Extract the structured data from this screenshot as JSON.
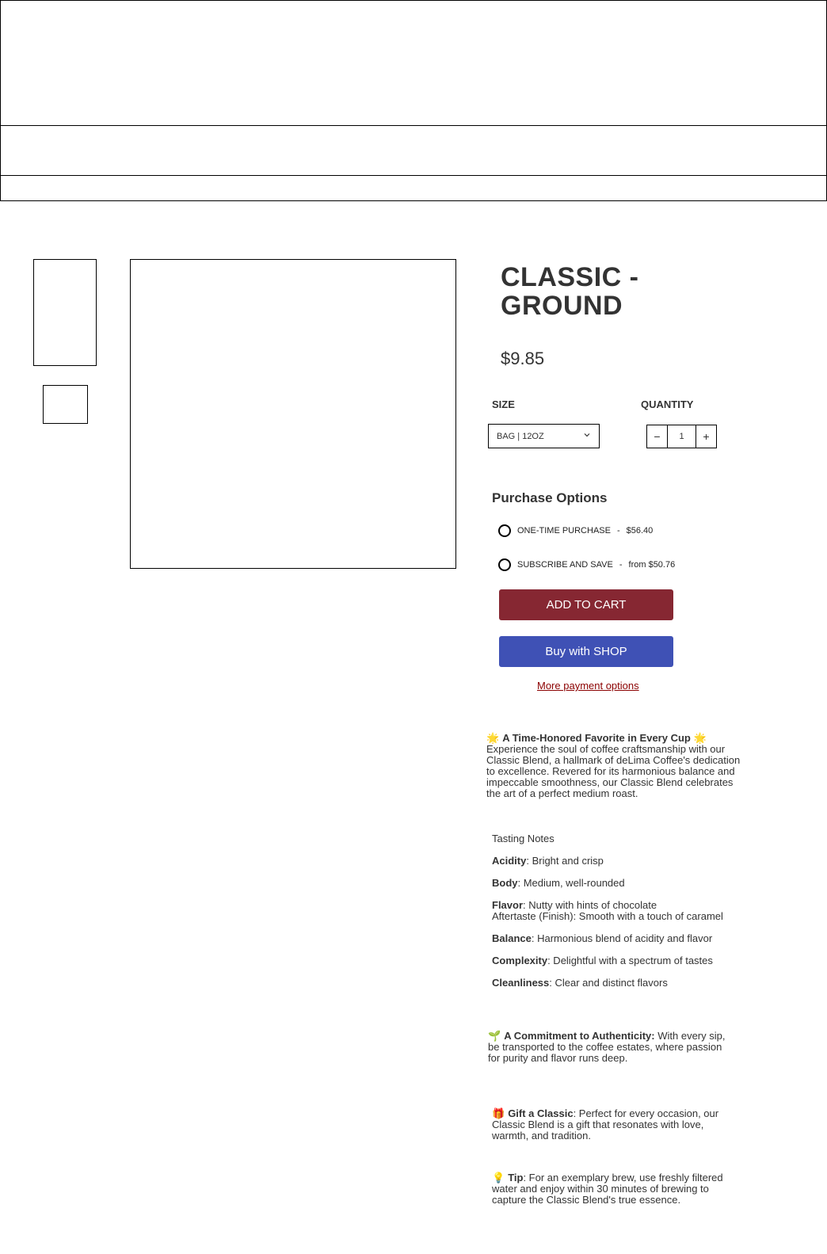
{
  "product": {
    "title": "CLASSIC - GROUND",
    "price": "$9.85",
    "size_label": "SIZE",
    "size_value": "BAG | 12OZ",
    "quantity_label": "QUANTITY",
    "quantity_value": "1",
    "minus": "−",
    "plus": "+"
  },
  "purchase": {
    "title": "Purchase Options",
    "options": [
      {
        "label": "ONE-TIME PURCHASE",
        "sep": "-",
        "price": "$56.40"
      },
      {
        "label": "SUBSCRIBE AND SAVE",
        "sep": "-",
        "price": "from $50.76"
      }
    ],
    "add_to_cart": "ADD TO CART",
    "buy_with_shop": "Buy with SHOP",
    "more_payment": "More payment options"
  },
  "description": {
    "intro_icon_left": "🌟",
    "intro_title": "A Time-Honored Favorite in Every Cup",
    "intro_icon_right": "🌟",
    "intro_text": "Experience the soul of coffee craftsmanship with our Classic Blend, a hallmark of deLima Coffee's dedication to excellence. Revered for its harmonious balance and impeccable smoothness, our Classic Blend celebrates the art of a perfect medium roast.",
    "tasting_title": "Tasting Notes",
    "notes": [
      {
        "key": "Acidity",
        "value": ": Bright and crisp"
      },
      {
        "key": "Body",
        "value": ": Medium, well-rounded"
      },
      {
        "key": "Flavor",
        "value": ": Nutty with hints of chocolate",
        "extra": "Aftertaste (Finish): Smooth with a touch of caramel"
      },
      {
        "key": "Balance",
        "value": ": Harmonious blend of acidity and flavor"
      },
      {
        "key": "Complexity",
        "value": ": Delightful with a spectrum of tastes"
      },
      {
        "key": "Cleanliness",
        "value": ": Clear and distinct flavors"
      }
    ],
    "authentic_icon": "🌱",
    "authentic_title": "A Commitment to Authenticity:",
    "authentic_text": " With every sip, be transported to the coffee estates, where passion for purity and flavor runs deep.",
    "gift_icon": "🎁",
    "gift_title": "Gift a Classic",
    "gift_text": ": Perfect for every occasion, our Classic Blend is a gift that resonates with love, warmth, and tradition.",
    "tip_icon": "💡",
    "tip_title": "Tip",
    "tip_text": ": For an exemplary brew, use freshly filtered water and enjoy within 30 minutes of brewing to capture the Classic Blend's true essence."
  }
}
